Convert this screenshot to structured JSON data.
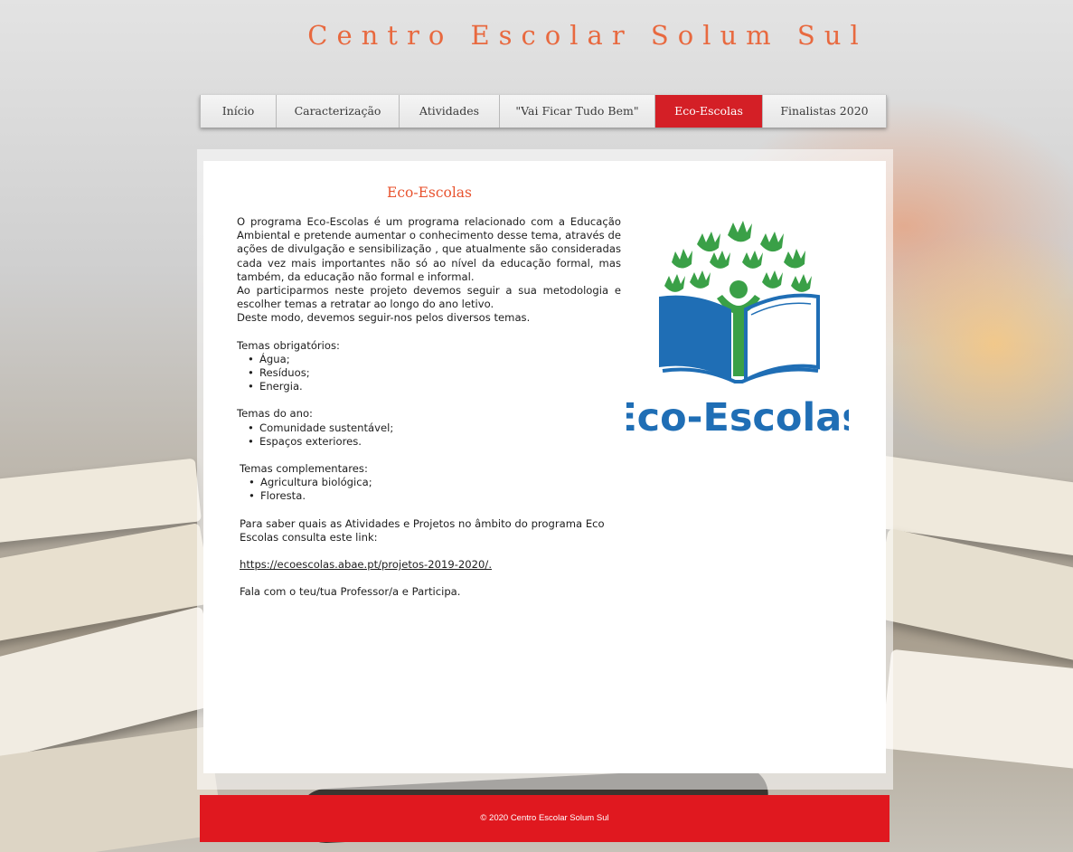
{
  "site": {
    "title": "Centro Escolar Solum Sul"
  },
  "nav": {
    "items": [
      {
        "label": "Início"
      },
      {
        "label": "Caracterização"
      },
      {
        "label": "Atividades"
      },
      {
        "label": "\"Vai Ficar Tudo Bem\""
      },
      {
        "label": "Eco-Escolas"
      },
      {
        "label": "Finalistas 2020"
      }
    ],
    "active": "Eco-Escolas"
  },
  "content": {
    "title": "Eco-Escolas",
    "intro": [
      "O programa Eco-Escolas é um programa relacionado com a Educação Ambiental e pretende aumentar o conhecimento desse tema, através de ações de divulgação  e sensibilização , que atualmente são consideradas cada vez mais importantes não só ao nível da educação formal, mas também, da educação não formal e informal.",
      " Ao participarmos neste projeto devemos seguir a sua metodologia e escolher temas a retratar ao longo do ano letivo.",
      "Deste modo, devemos seguir-nos pelos diversos temas."
    ],
    "mandatory": {
      "heading": "Temas obrigatórios:",
      "items": [
        "Água;",
        "Resíduos;",
        "Energia."
      ]
    },
    "year": {
      "heading": "Temas do ano:",
      "items": [
        "Comunidade sustentável;",
        "Espaços exteriores."
      ]
    },
    "complementary": {
      "heading": "Temas complementares:",
      "items": [
        "Agricultura biológica;",
        "Floresta."
      ]
    },
    "info": "Para saber quais as Atividades e Projetos no âmbito do programa Eco Escolas consulta este link:",
    "link": "https://ecoescolas.abae.pt/projetos-2019-2020/. ",
    "closing": "Fala com o teu/tua Professor/a e Participa."
  },
  "logo": {
    "text": "Eco-Escolas",
    "colors": {
      "green": "#3aa047",
      "blue": "#1f6eb5"
    }
  },
  "footer": {
    "text": "© 2020 Centro Escolar Solum Sul"
  },
  "colors": {
    "accent": "#d41f26",
    "title": "#e8693f",
    "footer": "#e0181f"
  }
}
